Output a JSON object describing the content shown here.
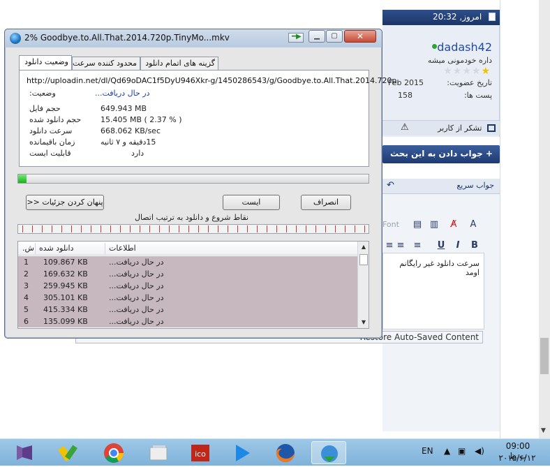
{
  "forum": {
    "post_header": "امروز, 20:32",
    "username": "dadash42",
    "user_title": "داره خودمونی میشه",
    "join_label": "تاریخ عضویت:",
    "join_value": "Feb 2015",
    "posts_label": "پست ها:",
    "posts_value": "158",
    "thanks_label": "تشکر از کاربر",
    "reply_button": "+ جواب دادن به این بحث",
    "quick_reply": "جواب سریع",
    "editor_text": "سرعت دانلود غیر رایگانم اومد",
    "font_placeholder": "Font",
    "restore_button": "Restore Auto-Saved Content"
  },
  "dialog": {
    "title": "2% Goodbye.to.All.That.2014.720p.TinyMo...mkv",
    "tabs": [
      "وضعیت دانلود",
      "محدود کننده سرعت",
      "گزینه های اتمام دانلود"
    ],
    "url": "http://uploadin.net/dl/Qd69oDAC1f5DyU946Xkr-g/1450286543/g/Goodbye.to.All.That.2014.720p.",
    "status_label": "وضعیت:",
    "status_value": "در حال دریافت...",
    "rows": [
      {
        "label": "حجم فایل",
        "value": "649.943  MB"
      },
      {
        "label": "حجم دانلود شده",
        "value": "15.405  MB  ( 2.37 % )"
      },
      {
        "label": "سرعت دانلود",
        "value": "668.062  KB/sec"
      },
      {
        "label": "زمان باقیمانده",
        "value": "15دقیقه و ۷ ثانیه"
      },
      {
        "label": "قابلیت ایست",
        "value": "دارد"
      }
    ],
    "progress_percent": 2.37,
    "buttons": {
      "hide_details": "پنهان کردن جزئیات <<",
      "pause": "ایست",
      "cancel": "انصراف"
    },
    "connections_label": "نقاط شروع و دانلود به ترتیب اتصال",
    "list_headers": {
      "num": "ش.",
      "downloaded": "دانلود شده",
      "info": "اطلاعات"
    },
    "list_rows": [
      {
        "num": "1",
        "size": "109.867  KB",
        "info": "در حال دریافت..."
      },
      {
        "num": "2",
        "size": "169.632  KB",
        "info": "در حال دریافت..."
      },
      {
        "num": "3",
        "size": "259.945  KB",
        "info": "در حال دریافت..."
      },
      {
        "num": "4",
        "size": "305.101  KB",
        "info": "در حال دریافت..."
      },
      {
        "num": "5",
        "size": "415.334  KB",
        "info": "در حال دریافت..."
      },
      {
        "num": "6",
        "size": "135.099  KB",
        "info": "در حال دریافت..."
      }
    ]
  },
  "taskbar": {
    "language": "EN",
    "time": "09:00 ب.ظ",
    "date": "۲۰۱۵/۶/۱۲"
  },
  "icons": [
    "app-logo-icon",
    "arrow-icon",
    "minimize-icon",
    "maximize-icon",
    "close-icon",
    "star-icon",
    "warning-icon",
    "thanks-icon",
    "back-arrow-icon"
  ],
  "colors": {
    "progress_fill": "#18b318",
    "list_row": "#c7b7bf",
    "forum_header": "#2e4f8c",
    "status_link": "#1a3aa6"
  }
}
